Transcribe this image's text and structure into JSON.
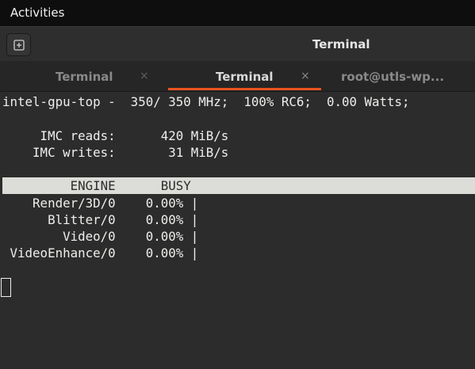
{
  "topbar": {
    "activities_label": "Activities"
  },
  "window": {
    "title": "Terminal",
    "new_tab_icon": "new-tab-icon"
  },
  "tabs": [
    {
      "label": "Terminal",
      "active": false,
      "close": "×"
    },
    {
      "label": "Terminal",
      "active": true,
      "close": "×"
    },
    {
      "label": "root@utls-wp...",
      "active": false
    }
  ],
  "terminal": {
    "status_line": "intel-gpu-top -  350/ 350 MHz;  100% RC6;  0.00 Watts;",
    "imc_reads": "     IMC reads:      420 MiB/s",
    "imc_writes": "    IMC writes:       31 MiB/s",
    "table_header": "         ENGINE      BUSY",
    "rows": [
      "    Render/3D/0    0.00% |",
      "      Blitter/0    0.00% |",
      "        Video/0    0.00% |",
      " VideoEnhance/0    0.00% |"
    ]
  },
  "colors": {
    "accent": "#e95420",
    "terminal_bg": "#2c2c2c",
    "header_bg": "#dcdcd9",
    "text": "#eeeeec"
  }
}
